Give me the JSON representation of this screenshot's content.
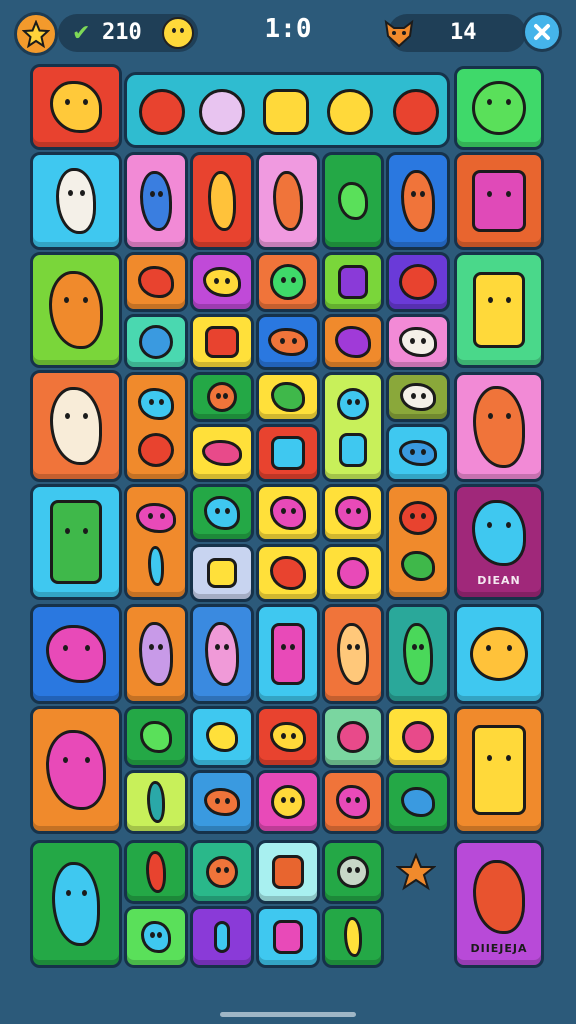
{
  "hud": {
    "left_score": "210",
    "center_score": "1:0",
    "right_score": "14",
    "check_glyph": "✔",
    "icons": [
      "star-icon",
      "smiley-icon",
      "fox-icon",
      "close-icon"
    ]
  },
  "tiles": {
    "dream_label_1": "DIEAN",
    "dream_label_2": "DIIEJEJA"
  },
  "colors": {
    "background": "#2c5a7a",
    "hud_pill": "#1f3f57",
    "accent_orange": "#f39a2c",
    "accent_blue": "#45b4ea"
  }
}
